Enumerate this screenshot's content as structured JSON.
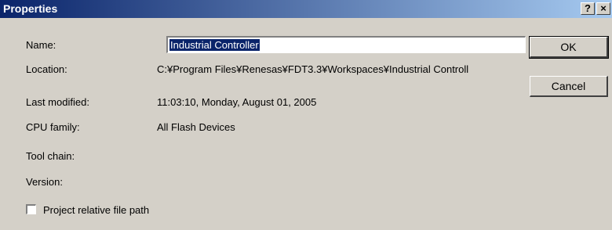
{
  "window": {
    "title": "Properties"
  },
  "titlebar_buttons": {
    "help": "?",
    "close": "×"
  },
  "fields": {
    "name": {
      "label": "Name:",
      "value": "Industrial Controller"
    },
    "location": {
      "label": "Location:",
      "value": "C:¥Program Files¥Renesas¥FDT3.3¥Workspaces¥Industrial Controll"
    },
    "last_modified": {
      "label": "Last modified:",
      "value": "11:03:10, Monday, August 01, 2005"
    },
    "cpu_family": {
      "label": "CPU family:",
      "value": "All Flash Devices"
    },
    "tool_chain": {
      "label": "Tool chain:",
      "value": ""
    },
    "version": {
      "label": "Version:",
      "value": ""
    }
  },
  "buttons": {
    "ok": "OK",
    "cancel": "Cancel"
  },
  "checkbox": {
    "label": "Project relative file path",
    "checked": false
  }
}
